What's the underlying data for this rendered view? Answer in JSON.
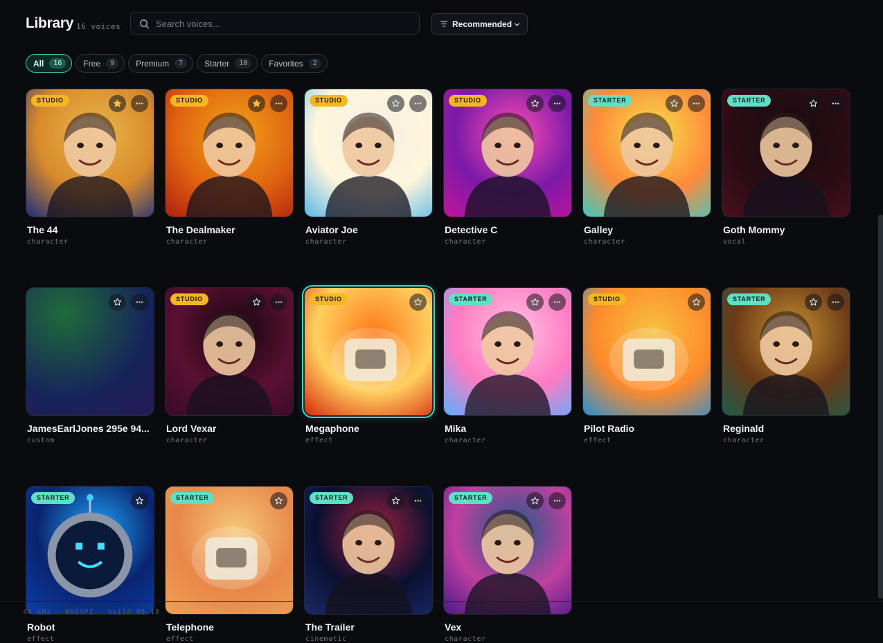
{
  "header": {
    "title": "Library",
    "count_label": "16 voices",
    "search_placeholder": "Search voices...",
    "sort_label": "Recommended"
  },
  "filters": [
    {
      "label": "All",
      "count": "16",
      "active": true
    },
    {
      "label": "Free",
      "count": "9",
      "active": false
    },
    {
      "label": "Premium",
      "count": "7",
      "active": false
    },
    {
      "label": "Starter",
      "count": "10",
      "active": false
    },
    {
      "label": "Favorites",
      "count": "2",
      "active": false
    }
  ],
  "voices": [
    {
      "name": "The 44",
      "category": "character",
      "badge": "STUDIO",
      "favorited": true,
      "has_menu": true,
      "selected": false,
      "art": "portrait",
      "colors": [
        "#1b2f7a",
        "#e9b64a",
        "#d88a2b"
      ]
    },
    {
      "name": "The Dealmaker",
      "category": "character",
      "badge": "STUDIO",
      "favorited": true,
      "has_menu": true,
      "selected": false,
      "art": "portrait",
      "colors": [
        "#b0200f",
        "#f0a21a",
        "#e06410"
      ]
    },
    {
      "name": "Aviator Joe",
      "category": "character",
      "badge": "STUDIO",
      "favorited": false,
      "has_menu": true,
      "selected": false,
      "art": "portrait",
      "colors": [
        "#5bb8e8",
        "#f5efe0",
        "#fff6dc"
      ]
    },
    {
      "name": "Detective C",
      "category": "character",
      "badge": "STUDIO",
      "favorited": false,
      "has_menu": true,
      "selected": false,
      "art": "portrait",
      "colors": [
        "#c2139a",
        "#ff4db2",
        "#7a1aa8"
      ]
    },
    {
      "name": "Galley",
      "category": "character",
      "badge": "STARTER",
      "favorited": false,
      "has_menu": true,
      "selected": false,
      "art": "portrait",
      "colors": [
        "#3fc9c0",
        "#f3e14a",
        "#ff8a3a"
      ]
    },
    {
      "name": "Goth Mommy",
      "category": "vocal",
      "badge": "STARTER",
      "favorited": false,
      "has_menu": true,
      "selected": false,
      "art": "portrait",
      "colors": [
        "#4a0f1c",
        "#1a0a10",
        "#2a0c14"
      ]
    },
    {
      "name": "JamesEarlJones 295e 94...",
      "category": "custom",
      "badge": "",
      "favorited": false,
      "has_menu": true,
      "selected": false,
      "art": "gradient",
      "colors": [
        "#1f6b3a",
        "#16245a",
        "#2a1a55"
      ]
    },
    {
      "name": "Lord Vexar",
      "category": "character",
      "badge": "STUDIO",
      "favorited": false,
      "has_menu": true,
      "selected": false,
      "art": "portrait",
      "colors": [
        "#3a0a2a",
        "#12060f",
        "#5a1030"
      ]
    },
    {
      "name": "Megaphone",
      "category": "effect",
      "badge": "STUDIO",
      "favorited": false,
      "has_menu": false,
      "selected": true,
      "art": "object",
      "colors": [
        "#d8280c",
        "#ff7a1a",
        "#ffd060"
      ]
    },
    {
      "name": "Mika",
      "category": "character",
      "badge": "STARTER",
      "favorited": false,
      "has_menu": true,
      "selected": false,
      "art": "portrait",
      "colors": [
        "#5ab0ff",
        "#ffc4e4",
        "#ff7ac2"
      ]
    },
    {
      "name": "Pilot Radio",
      "category": "effect",
      "badge": "STUDIO",
      "favorited": false,
      "has_menu": false,
      "selected": false,
      "art": "object",
      "colors": [
        "#2a8fd0",
        "#f5c242",
        "#ff8a2a"
      ]
    },
    {
      "name": "Reginald",
      "category": "character",
      "badge": "STARTER",
      "favorited": false,
      "has_menu": true,
      "selected": false,
      "art": "portrait",
      "colors": [
        "#1e5a4a",
        "#c8902e",
        "#6a3a18"
      ]
    },
    {
      "name": "Robot",
      "category": "effect",
      "badge": "STARTER",
      "favorited": false,
      "has_menu": false,
      "selected": false,
      "art": "robot",
      "colors": [
        "#0a3fa8",
        "#1ea8ff",
        "#0a2470"
      ]
    },
    {
      "name": "Telephone",
      "category": "effect",
      "badge": "STARTER",
      "favorited": false,
      "has_menu": false,
      "selected": false,
      "art": "object",
      "colors": [
        "#f0a050",
        "#f6c878",
        "#e8884a"
      ]
    },
    {
      "name": "The Trailer",
      "category": "cinematic",
      "badge": "STARTER",
      "favorited": false,
      "has_menu": true,
      "selected": false,
      "art": "portrait",
      "colors": [
        "#1a2a6a",
        "#a02040",
        "#0a1030"
      ]
    },
    {
      "name": "Vex",
      "category": "character",
      "badge": "STARTER",
      "favorited": false,
      "has_menu": true,
      "selected": false,
      "art": "portrait",
      "colors": [
        "#4a1a8a",
        "#1a5a8a",
        "#c040a0"
      ]
    }
  ],
  "footer": {
    "status": "48 kHz · WASAPI · build 05.18"
  },
  "icons": {
    "search": "search-icon",
    "sort": "sort-lines-icon",
    "chevron": "chevron-down-icon",
    "star": "star-icon",
    "more": "more-dots-icon"
  }
}
